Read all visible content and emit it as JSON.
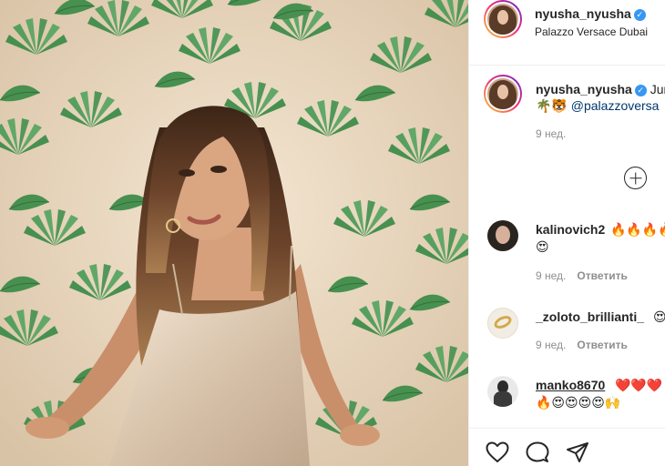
{
  "post": {
    "username": "nyusha_nyusha",
    "location": "Palazzo Versace Dubai"
  },
  "caption": {
    "username": "nyusha_nyusha",
    "text_start": "Jun",
    "emojis": "🌴🐯",
    "mention": "@palazzoversa",
    "time": "9 нед."
  },
  "comments": [
    {
      "username": "kalinovich2",
      "text": "🔥🔥🔥🔥",
      "text2": "😍",
      "time": "9 нед.",
      "reply": "Ответить"
    },
    {
      "username": "_zoloto_brillianti_",
      "text": "😍",
      "time": "9 нед.",
      "reply": "Ответить"
    },
    {
      "username": "manko8670",
      "text": "❤️❤️❤️",
      "text2": "🔥😍😍😍😍🙌",
      "time": "",
      "reply": ""
    }
  ],
  "icons": {
    "verified": "verified-badge-icon",
    "load_more": "plus-circle-icon",
    "like": "heart-icon",
    "comment": "comment-icon",
    "share": "share-icon"
  },
  "colors": {
    "verified": "#3897f0",
    "mention": "#00376b",
    "meta": "#8e8e8e",
    "border": "#efefef"
  }
}
